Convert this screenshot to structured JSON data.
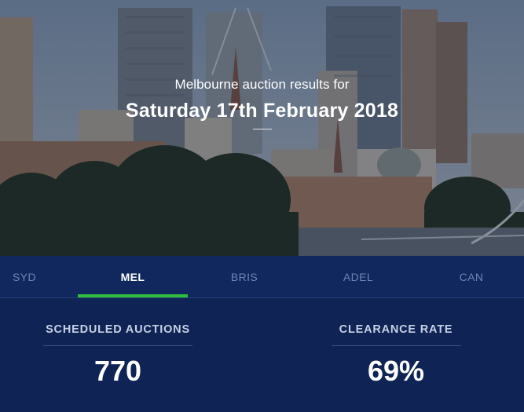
{
  "hero": {
    "subtitle": "Melbourne auction results for",
    "title": "Saturday 17th February 2018"
  },
  "tabs": [
    {
      "label": "SYD",
      "active": false
    },
    {
      "label": "MEL",
      "active": true
    },
    {
      "label": "BRIS",
      "active": false
    },
    {
      "label": "ADEL",
      "active": false
    },
    {
      "label": "CAN",
      "active": false
    }
  ],
  "stats": {
    "scheduled": {
      "label": "SCHEDULED AUCTIONS",
      "value": "770"
    },
    "clearance": {
      "label": "CLEARANCE RATE",
      "value": "69%"
    }
  },
  "colors": {
    "panel_bg": "#0f2455",
    "tab_bar_bg": "#10285e",
    "active_indicator": "#2fbf3c",
    "inactive_tab_text": "#6f84b5"
  }
}
